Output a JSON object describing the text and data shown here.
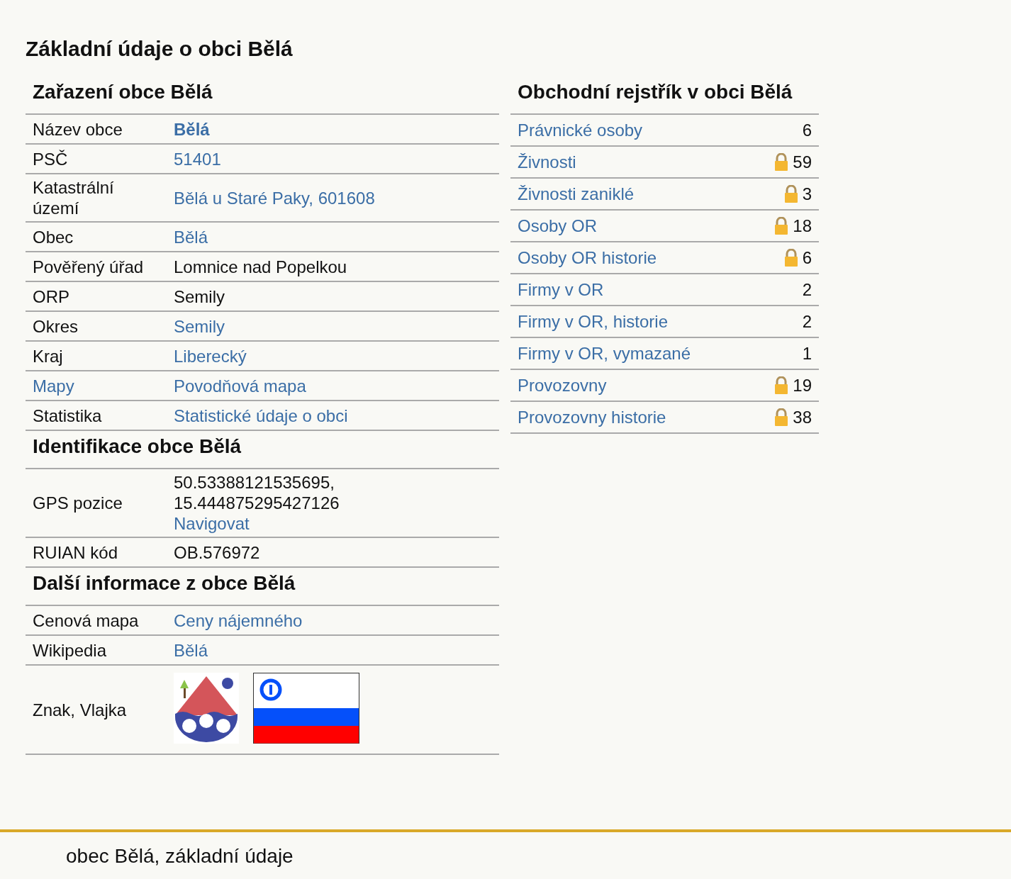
{
  "page_title": "Základní údaje o obci Bělá",
  "left_sections": [
    {
      "title": "Zařazení obce Bělá",
      "rows": [
        {
          "label": {
            "text": "Název obce",
            "link": false
          },
          "kind": "text",
          "values": [
            {
              "text": "Bělá",
              "link": true,
              "bold": true
            }
          ]
        },
        {
          "label": {
            "text": "PSČ",
            "link": false
          },
          "kind": "text",
          "values": [
            {
              "text": "51401",
              "link": true,
              "bold": false
            }
          ]
        },
        {
          "label": {
            "text": "Katastrální území",
            "link": false
          },
          "kind": "text",
          "values": [
            {
              "text": "Bělá u Staré Paky, 601608",
              "link": true,
              "bold": false
            }
          ]
        },
        {
          "label": {
            "text": "Obec",
            "link": false
          },
          "kind": "text",
          "values": [
            {
              "text": "Bělá",
              "link": true,
              "bold": false
            }
          ]
        },
        {
          "label": {
            "text": "Pověřený úřad",
            "link": false
          },
          "kind": "text",
          "values": [
            {
              "text": "Lomnice nad Popelkou",
              "link": false,
              "bold": false
            }
          ]
        },
        {
          "label": {
            "text": "ORP",
            "link": false
          },
          "kind": "text",
          "values": [
            {
              "text": "Semily",
              "link": false,
              "bold": false
            }
          ]
        },
        {
          "label": {
            "text": "Okres",
            "link": false
          },
          "kind": "text",
          "values": [
            {
              "text": "Semily",
              "link": true,
              "bold": false
            }
          ]
        },
        {
          "label": {
            "text": "Kraj",
            "link": false
          },
          "kind": "text",
          "values": [
            {
              "text": "Liberecký",
              "link": true,
              "bold": false
            }
          ]
        },
        {
          "label": {
            "text": "Mapy",
            "link": true
          },
          "kind": "text",
          "values": [
            {
              "text": "Povodňová mapa",
              "link": true,
              "bold": false
            }
          ]
        },
        {
          "label": {
            "text": "Statistika",
            "link": false
          },
          "kind": "text",
          "values": [
            {
              "text": "Statistické údaje o obci",
              "link": true,
              "bold": false
            }
          ]
        }
      ]
    },
    {
      "title": "Identifikace obce Bělá",
      "rows": [
        {
          "label": {
            "text": "GPS pozice",
            "link": false
          },
          "kind": "text",
          "values": [
            {
              "text": "50.53388121535695,",
              "link": false,
              "bold": false
            },
            {
              "text": "15.444875295427126",
              "link": false,
              "bold": false
            },
            {
              "text": "Navigovat",
              "link": true,
              "bold": false
            }
          ]
        },
        {
          "label": {
            "text": "RUIAN kód",
            "link": false
          },
          "kind": "text",
          "values": [
            {
              "text": "OB.576972",
              "link": false,
              "bold": false
            }
          ]
        }
      ]
    },
    {
      "title": "Další informace z obce Bělá",
      "rows": [
        {
          "label": {
            "text": "Cenová mapa",
            "link": false
          },
          "kind": "text",
          "values": [
            {
              "text": "Ceny nájemného",
              "link": true,
              "bold": false
            }
          ]
        },
        {
          "label": {
            "text": "Wikipedia",
            "link": false
          },
          "kind": "text",
          "values": [
            {
              "text": "Bělá",
              "link": true,
              "bold": false
            }
          ]
        },
        {
          "label": {
            "text": "Znak, Vlajka",
            "link": false
          },
          "kind": "emblems",
          "values": []
        }
      ]
    }
  ],
  "register": {
    "title": "Obchodní rejstřík v obci Bělá",
    "rows": [
      {
        "label": "Právnické osoby",
        "count": "6",
        "locked": false
      },
      {
        "label": "Živnosti",
        "count": "59",
        "locked": true
      },
      {
        "label": "Živnosti zaniklé",
        "count": "3",
        "locked": true
      },
      {
        "label": "Osoby OR",
        "count": "18",
        "locked": true
      },
      {
        "label": "Osoby OR historie",
        "count": "6",
        "locked": true
      },
      {
        "label": "Firmy v OR",
        "count": "2",
        "locked": false
      },
      {
        "label": "Firmy v OR, historie",
        "count": "2",
        "locked": false
      },
      {
        "label": "Firmy v OR, vymazané",
        "count": "1",
        "locked": false
      },
      {
        "label": "Provozovny",
        "count": "19",
        "locked": true
      },
      {
        "label": "Provozovny historie",
        "count": "38",
        "locked": true
      }
    ]
  },
  "footer": "obec Bělá, základní údaje"
}
